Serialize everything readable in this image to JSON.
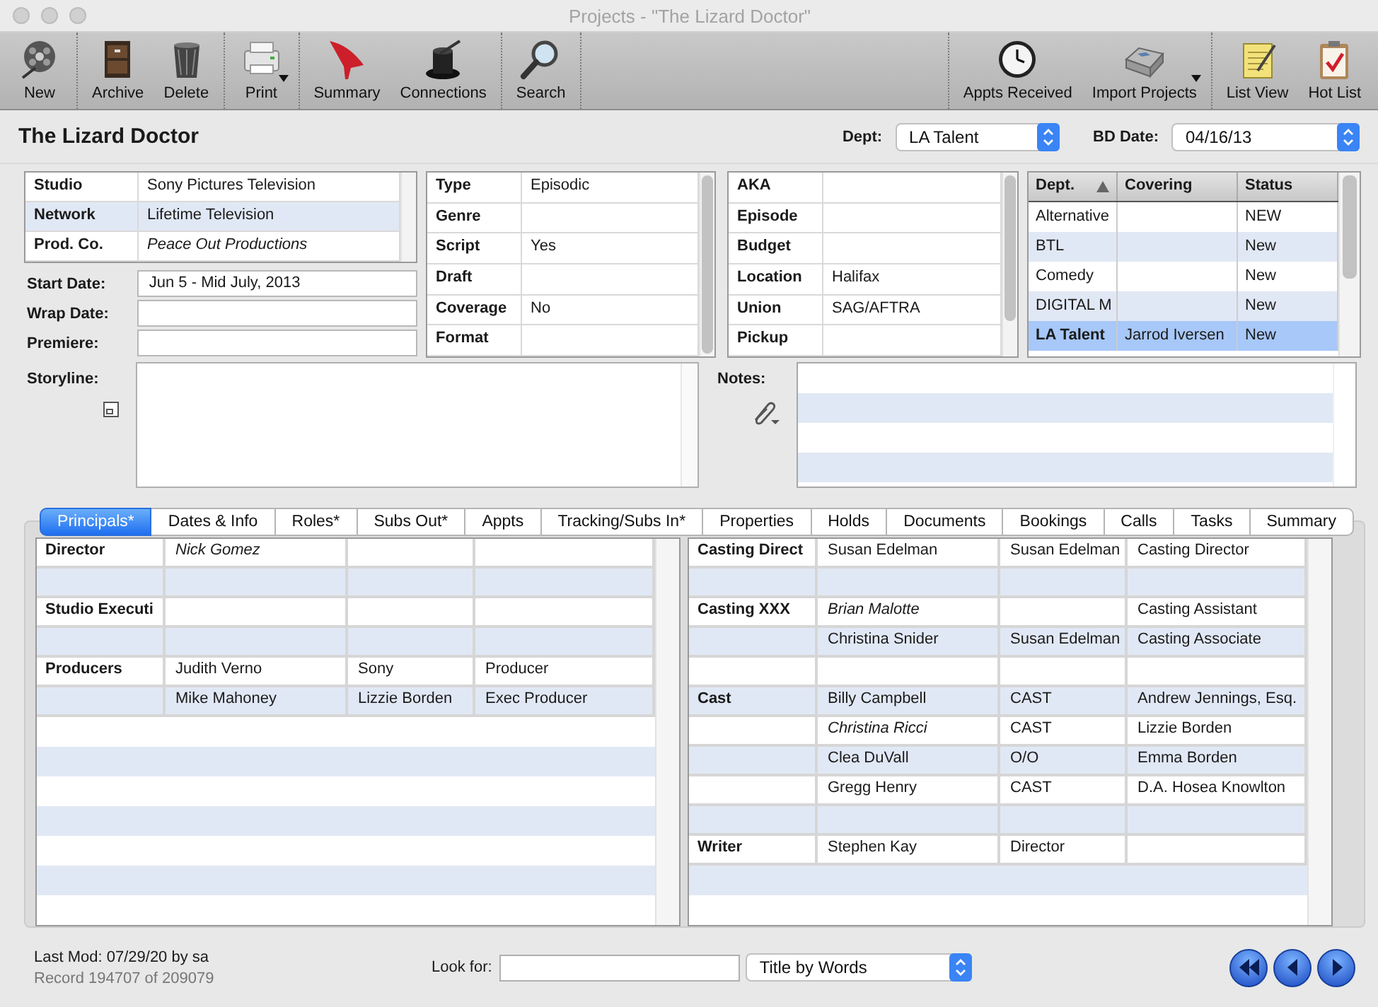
{
  "window": {
    "title": "Projects - \"The Lizard Doctor\""
  },
  "toolbar": {
    "left_groups": [
      [
        {
          "label": "New",
          "menu": false
        }
      ],
      [
        {
          "label": "Archive",
          "menu": false
        },
        {
          "label": "Delete",
          "menu": false
        }
      ],
      [
        {
          "label": "Print",
          "menu": true
        }
      ],
      [
        {
          "label": "Summary",
          "menu": false
        },
        {
          "label": "Connections",
          "menu": false
        }
      ],
      [
        {
          "label": "Search",
          "menu": false
        }
      ]
    ],
    "right_groups": [
      [
        {
          "label": "Appts Received",
          "menu": false
        },
        {
          "label": "Import Projects",
          "menu": true
        }
      ],
      [
        {
          "label": "List View",
          "menu": false
        },
        {
          "label": "Hot List",
          "menu": false
        }
      ]
    ]
  },
  "header": {
    "title": "The Lizard Doctor",
    "dept": {
      "label": "Dept:",
      "value": "LA Talent"
    },
    "bd_date": {
      "label": "BD Date:",
      "value": "04/16/13"
    }
  },
  "companies": [
    {
      "label": "Studio",
      "value": "Sony Pictures Television",
      "italic": false
    },
    {
      "label": "Network",
      "value": "Lifetime Television",
      "italic": false
    },
    {
      "label": "Prod. Co.",
      "value": "Peace Out Productions",
      "italic": true
    }
  ],
  "dates": [
    {
      "label": "Start Date:",
      "value": "Jun 5 - Mid July, 2013"
    },
    {
      "label": "Wrap Date:"
    },
    {
      "label": "Premiere:"
    }
  ],
  "details": [
    {
      "label": "Type",
      "value": "Episodic"
    },
    {
      "label": "Genre"
    },
    {
      "label": "Script",
      "value": "Yes"
    },
    {
      "label": "Draft"
    },
    {
      "label": "Coverage",
      "value": "No"
    },
    {
      "label": "Format"
    }
  ],
  "more_details": [
    {
      "label": "AKA"
    },
    {
      "label": "Episode"
    },
    {
      "label": "Budget"
    },
    {
      "label": "Location",
      "value": "Halifax"
    },
    {
      "label": "Union",
      "value": "SAG/AFTRA"
    },
    {
      "label": "Pickup"
    }
  ],
  "departments": {
    "columns": [
      "Dept.",
      "Covering",
      "Status"
    ],
    "rows": [
      {
        "dept": "Alternative",
        "status": "NEW",
        "selected": false
      },
      {
        "dept": "BTL",
        "status": "New",
        "selected": false
      },
      {
        "dept": "Comedy",
        "status": "New",
        "selected": false
      },
      {
        "dept": "DIGITAL M",
        "status": "New",
        "selected": false
      },
      {
        "dept": "LA Talent",
        "covering": "Jarrod Iversen",
        "status": "New",
        "selected": true
      }
    ]
  },
  "storyline": {
    "label": "Storyline:"
  },
  "notes": {
    "label": "Notes:"
  },
  "tabs": [
    {
      "label": "Principals*",
      "selected": true
    },
    {
      "label": "Dates & Info",
      "selected": false
    },
    {
      "label": "Roles*",
      "selected": false
    },
    {
      "label": "Subs Out*",
      "selected": false
    },
    {
      "label": "Appts",
      "selected": false
    },
    {
      "label": "Tracking/Subs In*",
      "selected": false
    },
    {
      "label": "Properties",
      "selected": false
    },
    {
      "label": "Holds",
      "selected": false
    },
    {
      "label": "Documents",
      "selected": false
    },
    {
      "label": "Bookings",
      "selected": false
    },
    {
      "label": "Calls",
      "selected": false
    },
    {
      "label": "Tasks",
      "selected": false
    },
    {
      "label": "Summary",
      "selected": false
    }
  ],
  "principals_left": [
    {
      "kind": "entry",
      "column_1": "Director",
      "column_2": "Nick  Gomez",
      "italic": true
    },
    {
      "kind": "blank"
    },
    {
      "kind": "entry",
      "column_1": "Studio Executi"
    },
    {
      "kind": "blank"
    },
    {
      "kind": "entry",
      "column_1": "Producers",
      "column_2": "Judith Verno",
      "column_3": "Sony",
      "column_4": "Producer",
      "italic": false
    },
    {
      "kind": "entry",
      "column_2": "Mike Mahoney",
      "column_3": "Lizzie Borden",
      "column_4": "Exec Producer",
      "italic": false
    }
  ],
  "principals_right": [
    {
      "kind": "entry",
      "column_1": "Casting Direct",
      "column_2": "Susan Edelman",
      "column_3": "Susan Edelman",
      "column_4": "Casting Director",
      "italic": false
    },
    {
      "kind": "blank"
    },
    {
      "kind": "entry",
      "column_1": "Casting XXX",
      "column_2": "Brian Malotte",
      "column_4": "Casting Assistant",
      "italic": true
    },
    {
      "kind": "entry",
      "column_2": "Christina Snider",
      "column_3": "Susan Edelman",
      "column_4": "Casting Associate",
      "italic": false
    },
    {
      "kind": "blank"
    },
    {
      "kind": "entry",
      "column_1": "Cast",
      "column_2": "Billy Campbell",
      "column_3": "CAST",
      "column_4": "Andrew Jennings, Esq.",
      "italic": false
    },
    {
      "kind": "entry",
      "column_2": "Christina Ricci",
      "column_3": "CAST",
      "column_4": "Lizzie Borden",
      "italic": true
    },
    {
      "kind": "entry",
      "column_2": "Clea DuVall",
      "column_3": "O/O",
      "column_4": "Emma Borden",
      "italic": false
    },
    {
      "kind": "entry",
      "column_2": "Gregg Henry",
      "column_3": "CAST",
      "column_4": "D.A. Hosea Knowlton",
      "italic": false
    },
    {
      "kind": "blank"
    },
    {
      "kind": "entry",
      "column_1": "Writer",
      "column_2": "Stephen Kay",
      "column_3": "Director",
      "italic": false
    }
  ],
  "footer": {
    "last_mod": "Last Mod: 07/29/20 by sa",
    "record": "Record 194707 of 209079",
    "look_for_label": "Look for:",
    "search_by": "Title by Words"
  }
}
